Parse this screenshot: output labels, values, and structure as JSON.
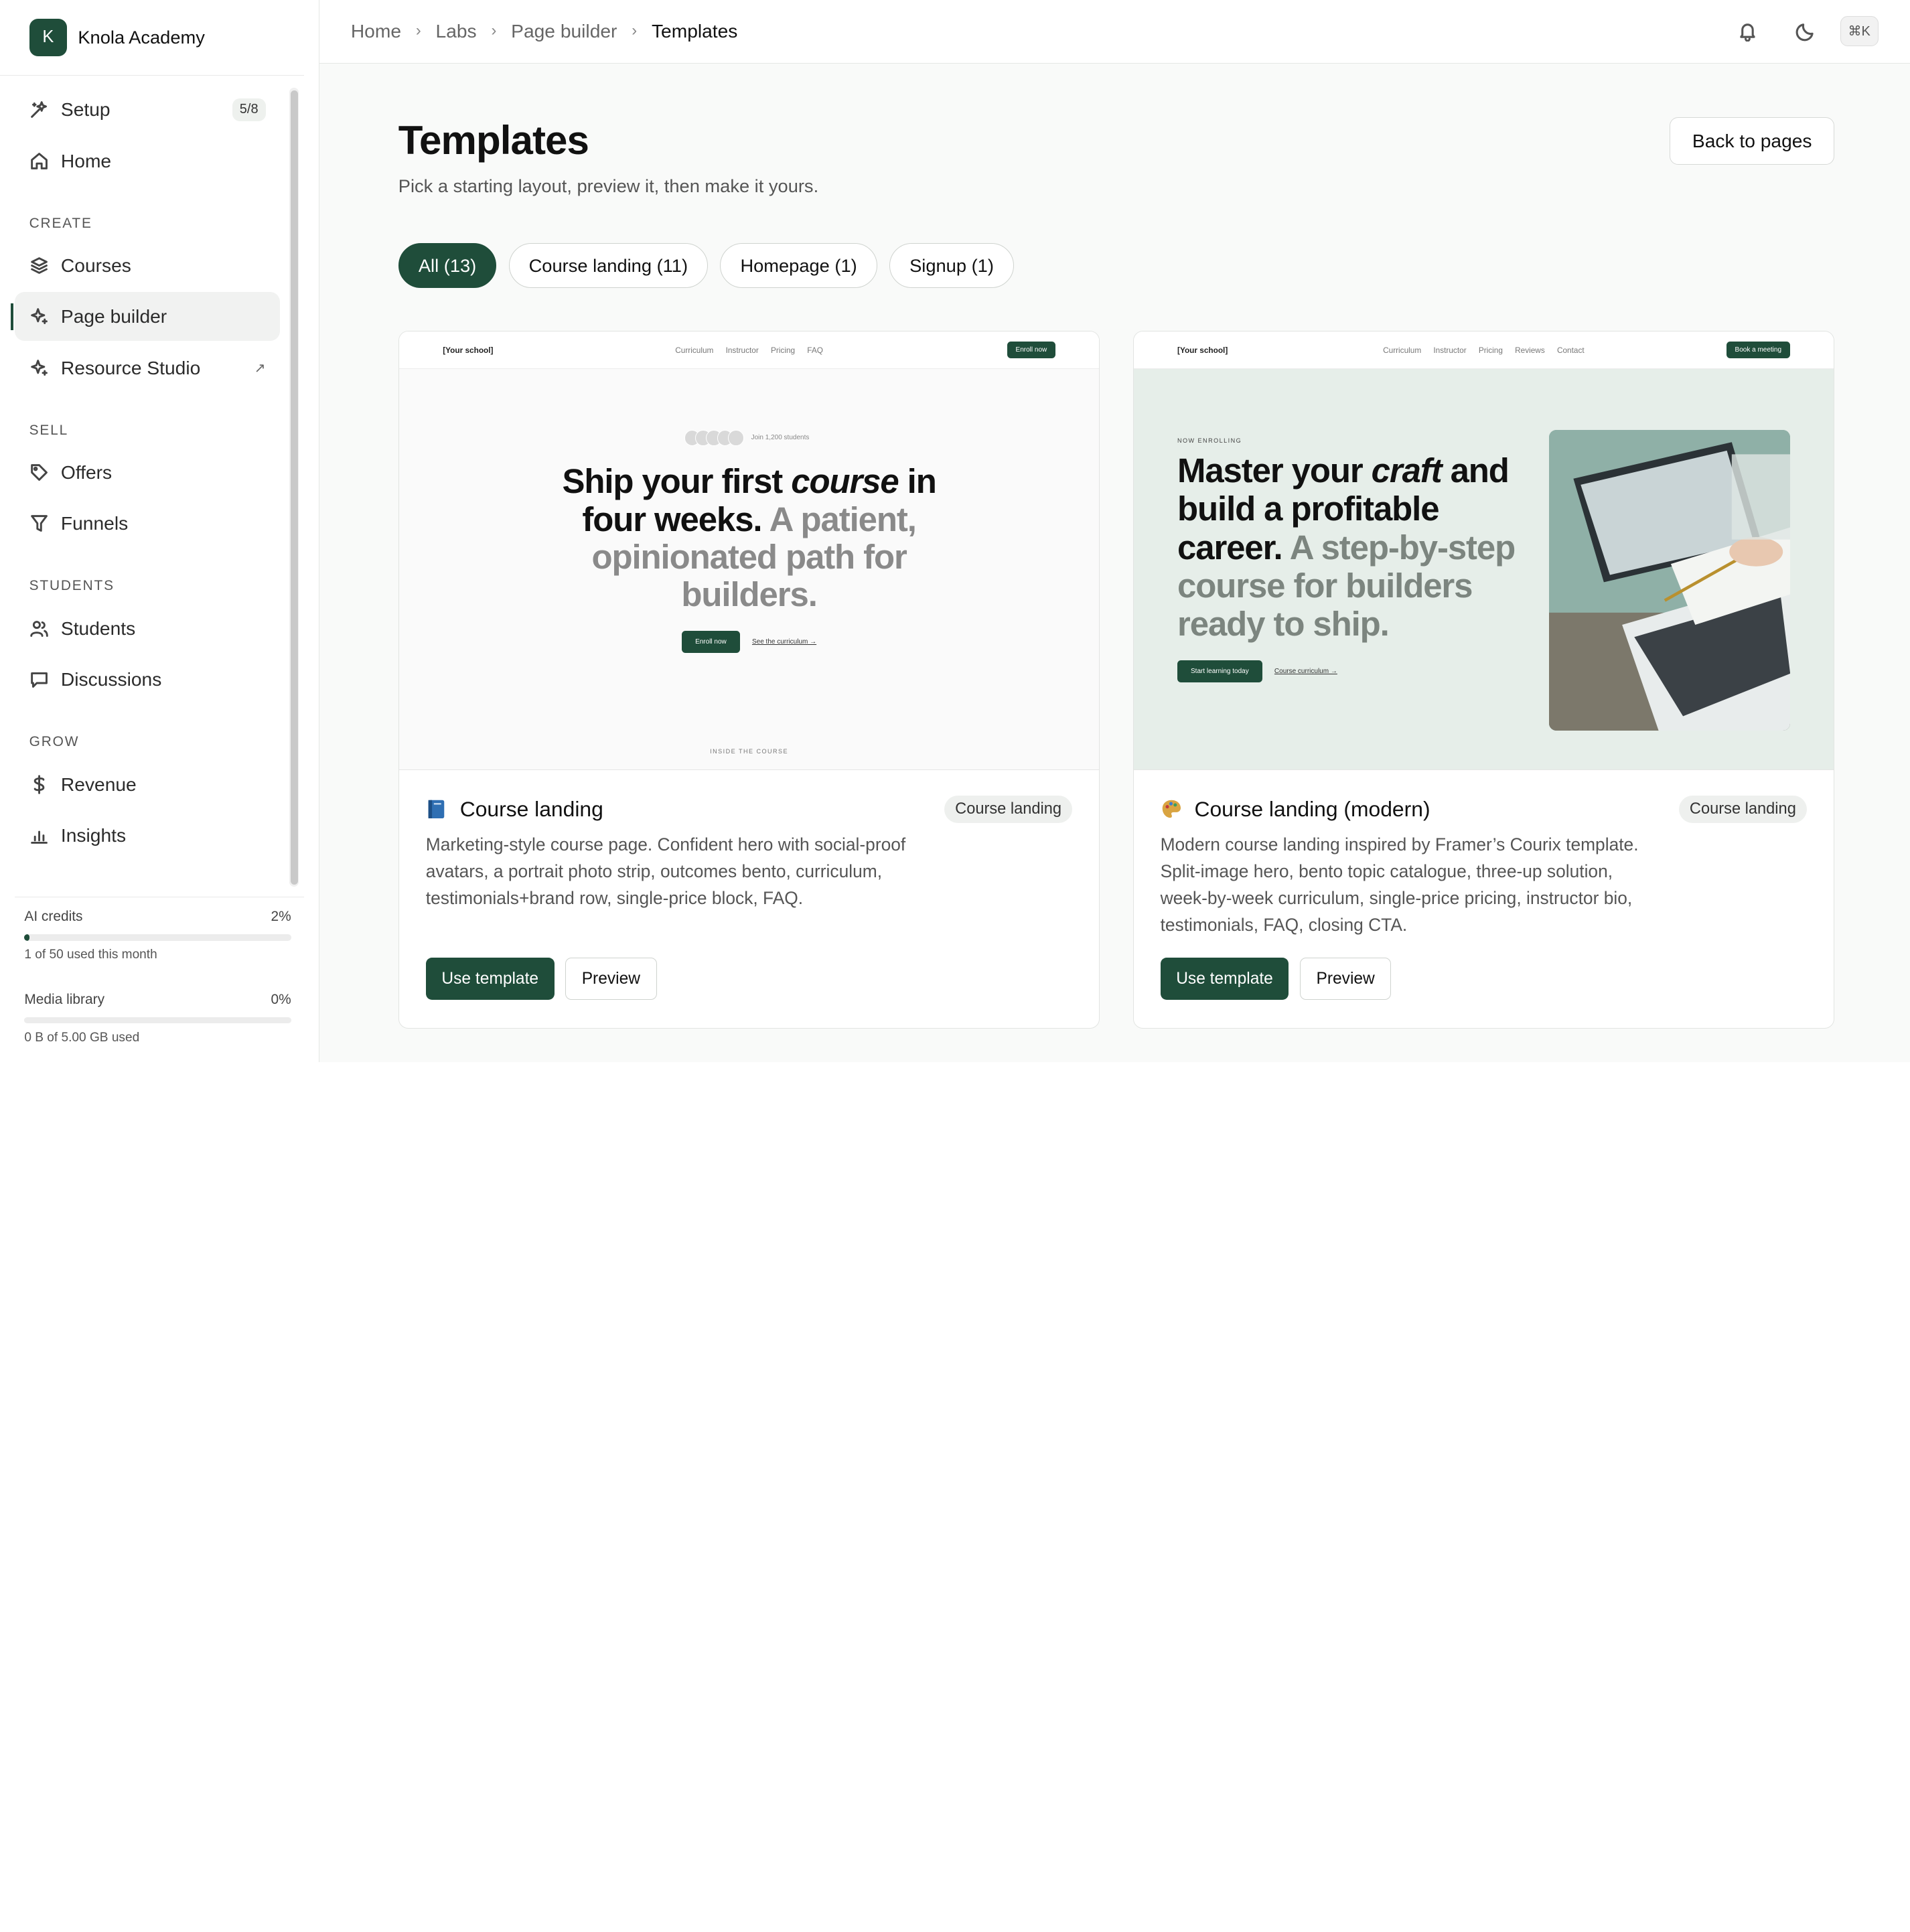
{
  "brand": {
    "initial": "K",
    "name": "Knola Academy"
  },
  "sidebar": {
    "setup": {
      "label": "Setup",
      "badge": "5/8"
    },
    "home": "Home",
    "sections": {
      "create": "CREATE",
      "sell": "SELL",
      "students": "STUDENTS",
      "grow": "GROW"
    },
    "items": {
      "courses": "Courses",
      "page_builder": "Page builder",
      "resource_studio": "Resource Studio",
      "resource_studio_ext": "↗",
      "offers": "Offers",
      "funnels": "Funnels",
      "students": "Students",
      "discussions": "Discussions",
      "revenue": "Revenue",
      "insights": "Insights"
    },
    "ai_credits": {
      "label": "AI credits",
      "percent": "2%",
      "fill": 0.02,
      "sub": "1 of 50 used this month"
    },
    "media_library": {
      "label": "Media library",
      "percent": "0%",
      "fill": 0,
      "sub": "0 B of 5.00 GB used"
    }
  },
  "breadcrumb": [
    "Home",
    "Labs",
    "Page builder",
    "Templates"
  ],
  "top_actions": {
    "shortcut": "⌘K"
  },
  "page": {
    "title": "Templates",
    "subtitle": "Pick a starting layout, preview it, then make it yours.",
    "back_button": "Back to pages"
  },
  "filters": [
    "All (13)",
    "Course landing (11)",
    "Homepage (1)",
    "Signup (1)"
  ],
  "cards": [
    {
      "title": "Course landing",
      "tag": "Course landing",
      "description": "Marketing-style course page. Confident hero with social-proof avatars, a portrait photo strip, outcomes bento, curriculum, testimonials+brand row, single-price block, FAQ.",
      "use_label": "Use template",
      "preview_label": "Preview",
      "preview": {
        "logo": "[Your school]",
        "links": [
          "Curriculum",
          "Instructor",
          "Pricing",
          "FAQ"
        ],
        "cta": "Enroll now",
        "join": "Join 1,200 students",
        "head_a": "Ship your first ",
        "head_italic": "course",
        "head_b": " in four weeks.",
        "head_muted": " A patient, opinionated path for builders.",
        "primary": "Enroll now",
        "secondary": "See the curriculum →",
        "inside": "INSIDE THE COURSE"
      }
    },
    {
      "title": "Course landing (modern)",
      "tag": "Course landing",
      "description": "Modern course landing inspired by Framer’s Courix template. Split-image hero, bento topic catalogue, three-up solution, week-by-week curriculum, single-price pricing, instructor bio, testimonials, FAQ, closing CTA.",
      "use_label": "Use template",
      "preview_label": "Preview",
      "preview": {
        "logo": "[Your school]",
        "links": [
          "Curriculum",
          "Instructor",
          "Pricing",
          "Reviews",
          "Contact"
        ],
        "cta": "Book a meeting",
        "enrolling": "NOW ENROLLING",
        "head_a": "Master your ",
        "head_italic": "craft",
        "head_b": " and build a profitable career.",
        "head_muted": " A step-by-step course for builders ready to ship.",
        "primary": "Start learning today",
        "secondary": "Course curriculum →"
      }
    }
  ]
}
